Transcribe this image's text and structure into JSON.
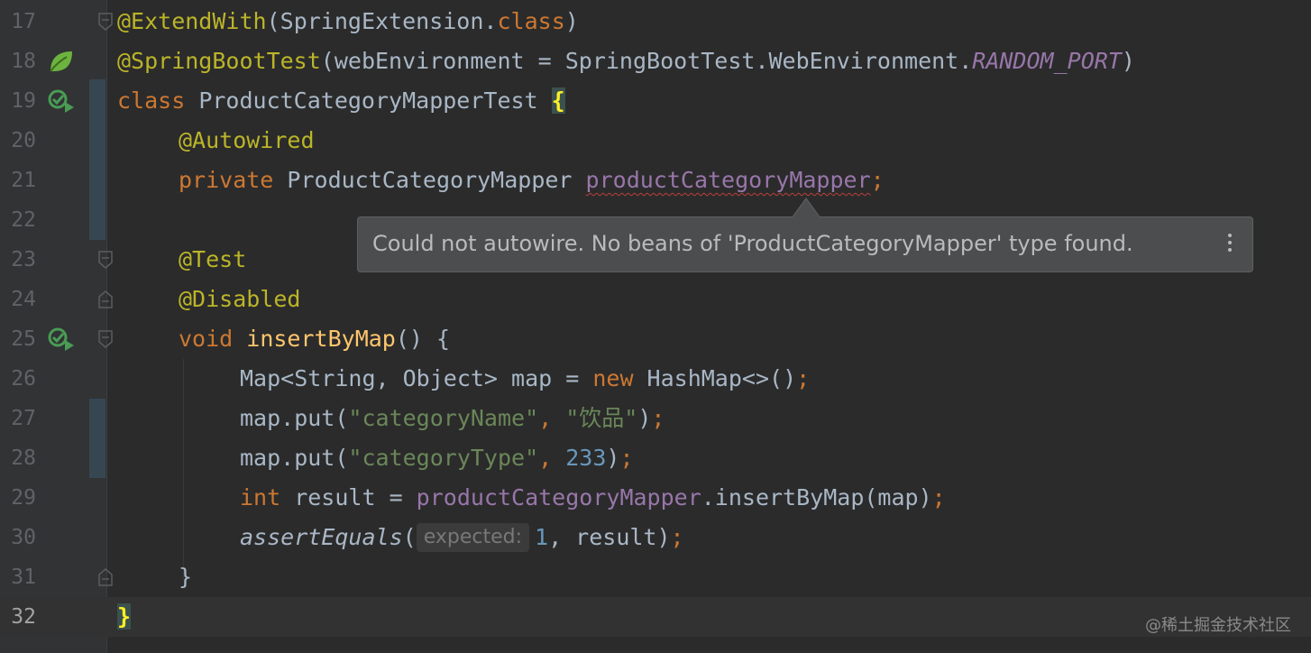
{
  "editor": {
    "lines": [
      {
        "number": "17",
        "parts": [
          "@ExtendWith",
          "(",
          "SpringExtension",
          ".",
          "class",
          ")"
        ]
      },
      {
        "number": "18",
        "parts": [
          "@SpringBootTest",
          "(",
          "webEnvironment",
          " = ",
          "SpringBootTest",
          ".",
          "WebEnvironment",
          ".",
          "RANDOM_PORT",
          ")"
        ]
      },
      {
        "number": "19",
        "parts": [
          "class",
          " ProductCategoryMapperTest ",
          "{"
        ]
      },
      {
        "number": "20",
        "parts": [
          "@Autowired"
        ]
      },
      {
        "number": "21",
        "parts": [
          "private",
          " ProductCategoryMapper ",
          "productCategoryMapper",
          ";"
        ]
      },
      {
        "number": "22",
        "parts": []
      },
      {
        "number": "23",
        "parts": [
          "@Test"
        ]
      },
      {
        "number": "24",
        "parts": [
          "@Disabled"
        ]
      },
      {
        "number": "25",
        "parts": [
          "void",
          " ",
          "insertByMap",
          "() {"
        ]
      },
      {
        "number": "26",
        "parts": [
          "Map<String, Object> map = ",
          "new",
          " HashMap<>()",
          ";"
        ]
      },
      {
        "number": "27",
        "parts": [
          "map.put(",
          "\"categoryName\"",
          ", ",
          "\"饮品\"",
          ")",
          ";"
        ]
      },
      {
        "number": "28",
        "parts": [
          "map.put(",
          "\"categoryType\"",
          ", ",
          "233",
          ")",
          ";"
        ]
      },
      {
        "number": "29",
        "parts": [
          "int",
          " result = ",
          "productCategoryMapper",
          ".insertByMap(map)",
          ";"
        ]
      },
      {
        "number": "30",
        "parts": [
          "assertEquals",
          "(",
          "expected:",
          "1",
          ", result)",
          ";"
        ]
      },
      {
        "number": "31",
        "parts": [
          "}"
        ]
      },
      {
        "number": "32",
        "parts": [
          "}"
        ]
      }
    ]
  },
  "tooltip": {
    "message": "Could not autowire. No beans of 'ProductCategoryMapper' type found.",
    "more_icon": "vertical-ellipsis-icon"
  },
  "gutter_icons": {
    "line18": "spring-bean-icon",
    "line19": "run-test-icon",
    "line25": "run-test-icon"
  },
  "watermark": "@稀土掘金技术社区",
  "colors": {
    "background": "#2b2b2b",
    "gutter": "#313335",
    "annotation": "#bbb529",
    "keyword": "#cc7832",
    "string": "#6a8759",
    "number": "#6897bb",
    "field": "#9876aa",
    "text": "#a9b7c6",
    "error_underline": "#bc3f3c",
    "tooltip_bg": "#4b4d4f"
  }
}
